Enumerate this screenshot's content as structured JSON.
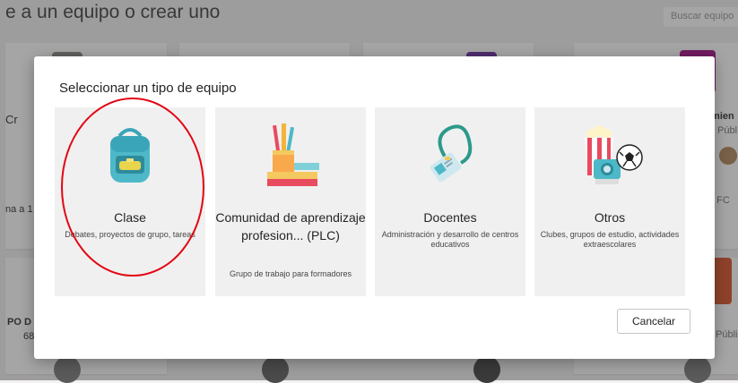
{
  "background": {
    "title": "e a un equipo o crear uno",
    "search_placeholder": "Buscar equipo",
    "left_cards": [
      {
        "name": "Cr",
        "subtitle": "na a 1"
      },
      {
        "name": "PO D",
        "subtitle": "68"
      }
    ],
    "right_cards": [
      {
        "name": "imien",
        "meta": "Públ",
        "subtitle": "o FC"
      },
      {
        "name": "",
        "meta": "Públic",
        "subtitle": ""
      }
    ]
  },
  "dialog": {
    "title": "Seleccionar un tipo de equipo",
    "tiles": [
      {
        "name": "Clase",
        "description": "Debates, proyectos de grupo, tareas",
        "icon": "backpack-icon"
      },
      {
        "name": "Comunidad de aprendizaje profesion... (PLC)",
        "description": "Grupo de trabajo para formadores",
        "icon": "books-pencils-icon"
      },
      {
        "name": "Docentes",
        "description": "Administración y desarrollo de centros educativos",
        "icon": "id-badge-icon"
      },
      {
        "name": "Otros",
        "description": "Clubes, grupos de estudio, actividades extraescolares",
        "icon": "popcorn-camera-ball-icon"
      }
    ],
    "cancel_label": "Cancelar"
  },
  "annotation_color": "#e30613"
}
